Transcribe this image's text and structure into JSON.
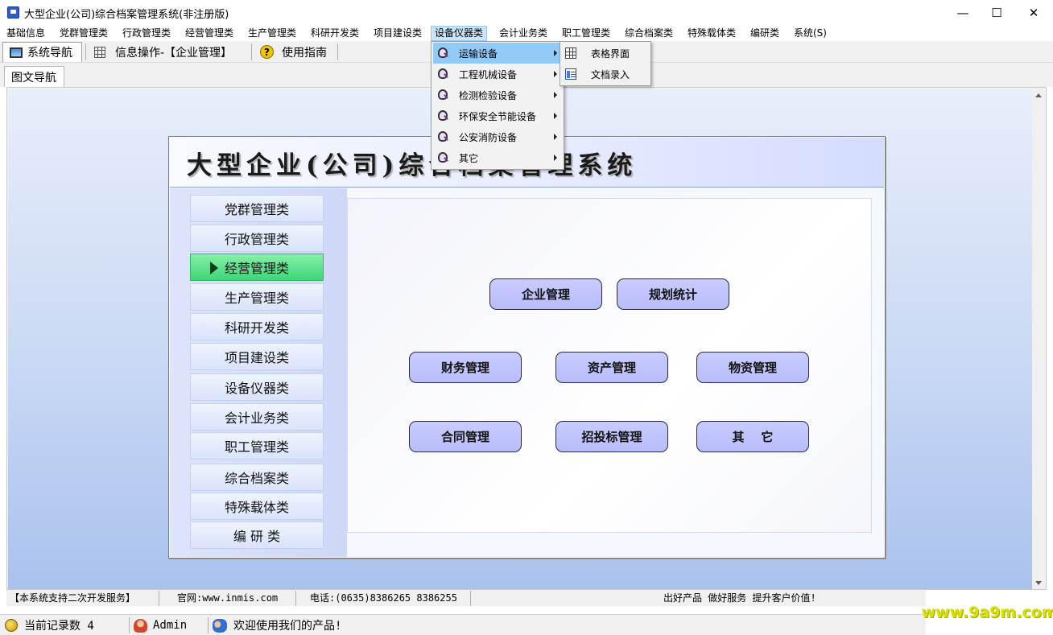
{
  "window": {
    "title": "大型企业(公司)综合档案管理系统(非注册版)",
    "controls": {
      "minimize": "—",
      "maximize": "☐",
      "close": "✕"
    }
  },
  "menubar": [
    "基础信息",
    "党群管理类",
    "行政管理类",
    "经营管理类",
    "生产管理类",
    "科研开发类",
    "项目建设类",
    "设备仪器类",
    "会计业务类",
    "职工管理类",
    "综合档案类",
    "特殊载体类",
    "编研类",
    "系统(S)"
  ],
  "toolbar": {
    "nav_label": "系统导航",
    "info_label": "信息操作-【企业管理】",
    "guide_label": "使用指南",
    "help_glyph": "?"
  },
  "page_tab": "图文导航",
  "panel": {
    "title": "大型企业(公司)综合档案管理系统",
    "nav": [
      "党群管理类",
      "行政管理类",
      "经营管理类",
      "生产管理类",
      "科研开发类",
      "项目建设类",
      "设备仪器类",
      "会计业务类",
      "职工管理类",
      "综合档案类",
      "特殊载体类",
      "编 研 类"
    ],
    "selected_nav": "经营管理类",
    "modules": [
      "企业管理",
      "规划统计",
      "财务管理",
      "资产管理",
      "物资管理",
      "合同管理",
      "招投标管理",
      "其    它"
    ]
  },
  "dropdown": {
    "items": [
      "运输设备",
      "工程机械设备",
      "检测检验设备",
      "环保安全节能设备",
      "公安消防设备",
      "其它"
    ],
    "highlighted": "运输设备",
    "submenu": [
      "表格界面",
      "文档录入"
    ]
  },
  "infobar": {
    "service": "【本系统支持二次开发服务】",
    "website": "官网:www.inmis.com",
    "phone": "电话:(0635)8386265 8386255",
    "slogan": "出好产品 做好服务 提升客户价值!"
  },
  "statusbar": {
    "records": "当前记录数 4",
    "user": "Admin",
    "welcome": "欢迎使用我们的产品!"
  },
  "watermark": "www.9a9m.com",
  "colors": {
    "selected_nav": "#3ed577",
    "module_button": "#c0c4fd",
    "menu_highlight": "#91c9f7"
  }
}
